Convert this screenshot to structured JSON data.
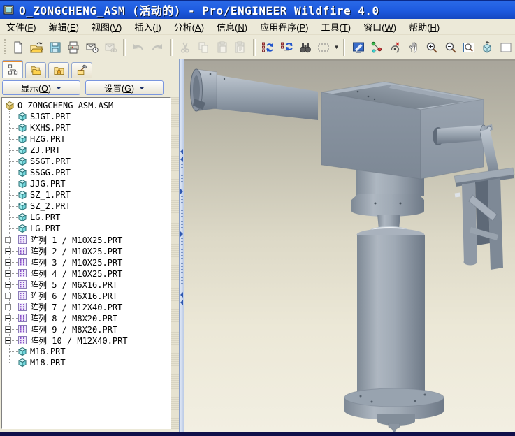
{
  "window": {
    "title": "O_ZONGCHENG_ASM (活动的) - Pro/ENGINEER Wildfire 4.0"
  },
  "menubar": {
    "items": [
      "文件(F)",
      "编辑(E)",
      "视图(V)",
      "插入(I)",
      "分析(A)",
      "信息(N)",
      "应用程序(P)",
      "工具(T)",
      "窗口(W)",
      "帮助(H)"
    ]
  },
  "toolbar": {
    "groups": [
      [
        {
          "name": "new-file",
          "disabled": false
        },
        {
          "name": "open-file",
          "disabled": false
        },
        {
          "name": "save",
          "disabled": false
        },
        {
          "name": "print",
          "disabled": false
        },
        {
          "name": "send-email",
          "disabled": false
        },
        {
          "name": "email-link",
          "disabled": true
        }
      ],
      [
        {
          "name": "undo",
          "disabled": true
        },
        {
          "name": "redo",
          "disabled": true
        }
      ],
      [
        {
          "name": "cut",
          "disabled": true
        },
        {
          "name": "copy",
          "disabled": true
        },
        {
          "name": "paste",
          "disabled": true
        },
        {
          "name": "paste-special",
          "disabled": true
        }
      ],
      [
        {
          "name": "regenerate",
          "disabled": false
        },
        {
          "name": "regenerate-custom",
          "disabled": false
        },
        {
          "name": "find",
          "disabled": false
        },
        {
          "name": "select-box",
          "disabled": false,
          "dropdown": true
        }
      ],
      [
        {
          "name": "repaint",
          "disabled": false
        },
        {
          "name": "orient-mode",
          "disabled": false
        },
        {
          "name": "spin-center",
          "disabled": false
        },
        {
          "name": "pan",
          "disabled": false
        },
        {
          "name": "zoom-in",
          "disabled": false
        },
        {
          "name": "zoom-out",
          "disabled": false
        },
        {
          "name": "refit",
          "disabled": false
        },
        {
          "name": "saved-views",
          "disabled": false
        },
        {
          "name": "view-manager",
          "disabled": false
        }
      ]
    ]
  },
  "navigator": {
    "tabs": [
      {
        "name": "model-tree",
        "selected": true
      },
      {
        "name": "folder-browser",
        "selected": false
      },
      {
        "name": "favorites",
        "selected": false
      },
      {
        "name": "history",
        "selected": false
      }
    ],
    "display_button": {
      "label": "显示(O)"
    },
    "settings_button": {
      "label": "设置(G)"
    },
    "model_tree": {
      "root": {
        "label": "O_ZONGCHENG_ASM.ASM",
        "type": "assembly"
      },
      "items": [
        {
          "label": "SJGT.PRT",
          "type": "part"
        },
        {
          "label": "KXHS.PRT",
          "type": "part"
        },
        {
          "label": "HZG.PRT",
          "type": "part"
        },
        {
          "label": "ZJ.PRT",
          "type": "part"
        },
        {
          "label": "SSGT.PRT",
          "type": "part"
        },
        {
          "label": "SSGG.PRT",
          "type": "part"
        },
        {
          "label": "JJG.PRT",
          "type": "part"
        },
        {
          "label": "SZ_1.PRT",
          "type": "part"
        },
        {
          "label": "SZ_2.PRT",
          "type": "part"
        },
        {
          "label": "LG.PRT",
          "type": "part"
        },
        {
          "label": "LG.PRT",
          "type": "part"
        },
        {
          "label": "阵列 1 / M10X25.PRT",
          "type": "pattern"
        },
        {
          "label": "阵列 2 / M10X25.PRT",
          "type": "pattern"
        },
        {
          "label": "阵列 3 / M10X25.PRT",
          "type": "pattern"
        },
        {
          "label": "阵列 4 / M10X25.PRT",
          "type": "pattern"
        },
        {
          "label": "阵列 5 / M6X16.PRT",
          "type": "pattern"
        },
        {
          "label": "阵列 6 / M6X16.PRT",
          "type": "pattern"
        },
        {
          "label": "阵列 7 / M12X40.PRT",
          "type": "pattern"
        },
        {
          "label": "阵列 8 / M8X20.PRT",
          "type": "pattern"
        },
        {
          "label": "阵列 9 / M8X20.PRT",
          "type": "pattern"
        },
        {
          "label": "阵列 10 / M12X40.PRT",
          "type": "pattern"
        },
        {
          "label": "M18.PRT",
          "type": "part"
        },
        {
          "label": "M18.PRT",
          "type": "part"
        }
      ]
    }
  },
  "colors": {
    "titlebar_blue": "#1d5adf",
    "panel_beige": "#ece9d8",
    "selected_tab_stripe": "#e68b2c",
    "viewport_top": "#a8a59b",
    "viewport_bottom": "#f2efe2",
    "model_gray": "#97a1ac",
    "border_blue": "#7a96df",
    "bottom_strip": "#10104a"
  }
}
